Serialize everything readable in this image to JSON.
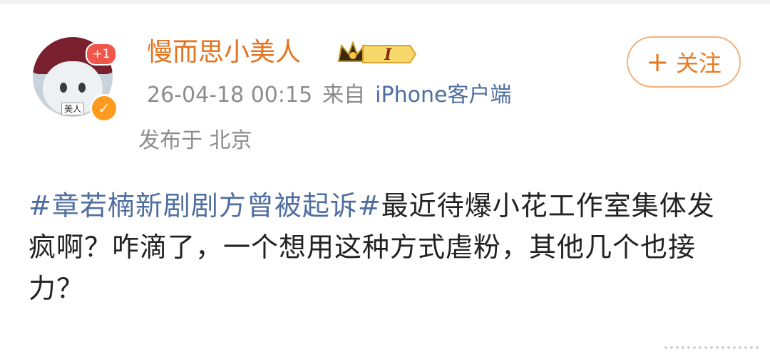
{
  "user": {
    "name": "慢而思小美人",
    "avatar_tag": "美人",
    "notification_count": "+1"
  },
  "meta": {
    "timestamp": "26-04-18 00:15",
    "from_label": "来自",
    "source": "iPhone客户端",
    "location": "发布于 北京"
  },
  "follow_button": {
    "label": "关注"
  },
  "post": {
    "hashtag": "#章若楠新剧剧方曾被起诉#",
    "body": "最近待爆小花工作室集体发疯啊？咋滴了，一个想用这种方式虐粉，其他几个也接力？"
  },
  "vip": {
    "level": "I"
  },
  "colors": {
    "accent": "#e3731e",
    "link": "#4e6ea0",
    "meta": "#8c8c8c",
    "badge": "#f0564a"
  }
}
